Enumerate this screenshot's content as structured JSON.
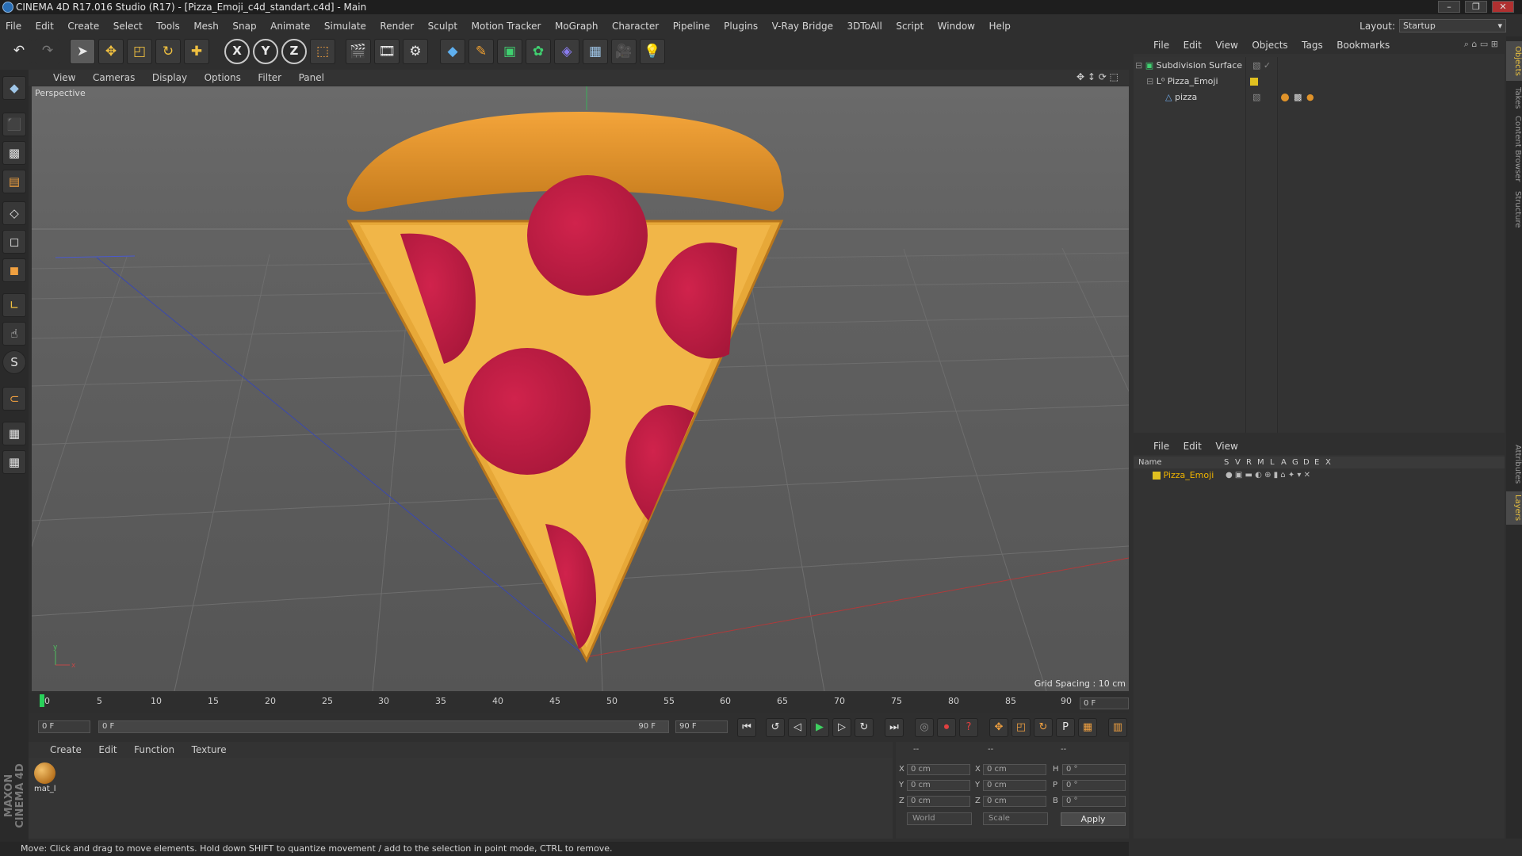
{
  "window": {
    "title": "CINEMA 4D R17.016 Studio (R17) - [Pizza_Emoji_c4d_standart.c4d] - Main",
    "buttons": [
      "–",
      "❐",
      "✕"
    ]
  },
  "menubar": [
    "File",
    "Edit",
    "Create",
    "Select",
    "Tools",
    "Mesh",
    "Snap",
    "Animate",
    "Simulate",
    "Render",
    "Sculpt",
    "Motion Tracker",
    "MoGraph",
    "Character",
    "Pipeline",
    "Plugins",
    "V-Ray Bridge",
    "3DToAll",
    "Script",
    "Window",
    "Help"
  ],
  "layout": {
    "label": "Layout:",
    "value": "Startup"
  },
  "toolbar": {
    "axis_x": "X",
    "axis_y": "Y",
    "axis_z": "Z",
    "icons": [
      "undo-icon",
      "redo-icon",
      "select-arrow-icon",
      "move-icon",
      "scale-icon",
      "rotate-icon",
      "transform-icon",
      "axis-x-icon",
      "axis-y-icon",
      "axis-z-icon",
      "coordinate-system-icon",
      "render-view-icon",
      "render-picture-viewer-icon",
      "render-settings-icon",
      "cube-icon",
      "pen-spline-icon",
      "subdivision-icon",
      "mograph-cloner-icon",
      "deformer-icon",
      "floor-icon",
      "camera-icon",
      "light-icon"
    ]
  },
  "viewport": {
    "menu": [
      "View",
      "Cameras",
      "Display",
      "Options",
      "Filter",
      "Panel"
    ],
    "label": "Perspective",
    "grid_spacing": "Grid Spacing : 10 cm",
    "nav_icons": [
      "pan-icon",
      "dolly-icon",
      "orbit-icon",
      "maximize-icon"
    ]
  },
  "timeline": {
    "ticks": [
      "0",
      "5",
      "10",
      "15",
      "20",
      "25",
      "30",
      "35",
      "40",
      "45",
      "50",
      "55",
      "60",
      "65",
      "70",
      "75",
      "80",
      "85",
      "90"
    ],
    "current_frame": "0 F",
    "start_field": "0 F",
    "range_start": "0 F",
    "range_end": "90 F",
    "end_field": "90 F"
  },
  "material_manager": {
    "menu": [
      "Create",
      "Edit",
      "Function",
      "Texture"
    ],
    "materials": [
      {
        "name": "mat_l"
      }
    ]
  },
  "coordinates": {
    "headers": [
      "--",
      "--",
      "--"
    ],
    "rows": [
      {
        "pos_label": "X",
        "pos": "0 cm",
        "size_label": "X",
        "size": "0 cm",
        "rot_label": "H",
        "rot": "0 °"
      },
      {
        "pos_label": "Y",
        "pos": "0 cm",
        "size_label": "Y",
        "size": "0 cm",
        "rot_label": "P",
        "rot": "0 °"
      },
      {
        "pos_label": "Z",
        "pos": "0 cm",
        "size_label": "Z",
        "size": "0 cm",
        "rot_label": "B",
        "rot": "0 °"
      }
    ],
    "mode": "World",
    "transform": "Scale",
    "apply": "Apply"
  },
  "status": "Move: Click and drag to move elements. Hold down SHIFT to quantize movement / add to the selection in point mode, CTRL to remove.",
  "objects": {
    "menu": [
      "File",
      "Edit",
      "View",
      "Objects",
      "Tags",
      "Bookmarks"
    ],
    "tree": [
      {
        "name": "Subdivision Surface",
        "depth": 0
      },
      {
        "name": "Pizza_Emoji",
        "depth": 1
      },
      {
        "name": "pizza",
        "depth": 2
      }
    ]
  },
  "layers": {
    "menu": [
      "File",
      "Edit",
      "View"
    ],
    "columns": [
      "Name",
      "S",
      "V",
      "R",
      "M",
      "L",
      "A",
      "G",
      "D",
      "E",
      "X"
    ],
    "rows": [
      {
        "name": "Pizza_Emoji",
        "color": "#e0c020"
      }
    ]
  },
  "side_tabs": [
    "Objects",
    "Takes",
    "Content Browser",
    "Structure",
    "Attributes",
    "Layers"
  ],
  "brand": {
    "logo_text": "MAXON CINEMA 4D"
  },
  "colors": {
    "crust": "#e0932a",
    "cheese": "#f0b544",
    "pepperoni": "#c21d43",
    "viewport_bg": "#5d5d5d",
    "accent_layer": "#f0b400"
  }
}
